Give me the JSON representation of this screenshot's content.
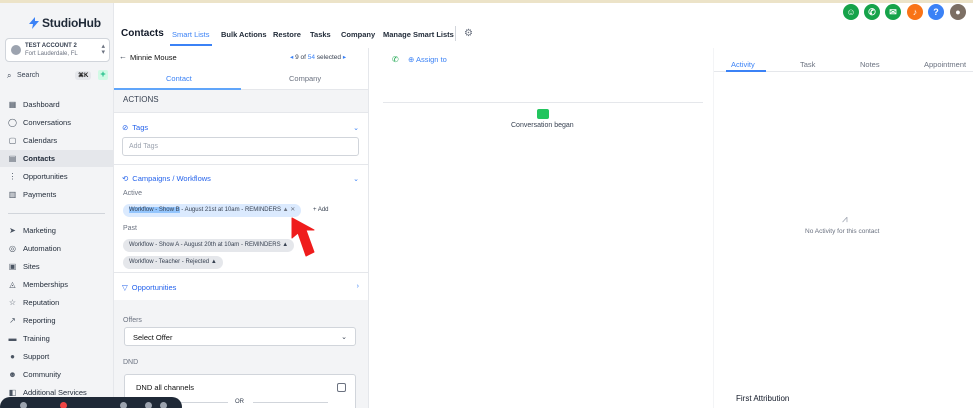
{
  "brand": {
    "name": "StudioHub"
  },
  "account": {
    "name": "TEST ACCOUNT 2",
    "location": "Fort Lauderdale, FL"
  },
  "search": {
    "label": "Search",
    "shortcut": "⌘K"
  },
  "sidebar": {
    "items": [
      {
        "label": "Dashboard",
        "icon": "dashboard-icon"
      },
      {
        "label": "Conversations",
        "icon": "chat-icon"
      },
      {
        "label": "Calendars",
        "icon": "calendar-icon"
      },
      {
        "label": "Contacts",
        "icon": "contacts-icon"
      },
      {
        "label": "Opportunities",
        "icon": "opportunities-icon"
      },
      {
        "label": "Payments",
        "icon": "payments-icon"
      },
      {
        "label": "Marketing",
        "icon": "send-icon"
      },
      {
        "label": "Automation",
        "icon": "automation-icon"
      },
      {
        "label": "Sites",
        "icon": "sites-icon"
      },
      {
        "label": "Memberships",
        "icon": "memberships-icon"
      },
      {
        "label": "Reputation",
        "icon": "star-icon"
      },
      {
        "label": "Reporting",
        "icon": "reporting-icon"
      },
      {
        "label": "Training",
        "icon": "training-icon"
      },
      {
        "label": "Support",
        "icon": "support-icon"
      },
      {
        "label": "Community",
        "icon": "community-icon"
      },
      {
        "label": "Additional Services",
        "icon": "services-icon"
      }
    ],
    "active": "Contacts"
  },
  "header": {
    "title": "Contacts",
    "tabs": [
      "Smart Lists",
      "Bulk Actions",
      "Restore",
      "Tasks",
      "Company",
      "Manage Smart Lists"
    ],
    "selected_tab": "Smart Lists"
  },
  "topicons": [
    {
      "color": "#16a34a",
      "glyph": "☺"
    },
    {
      "color": "#16a34a",
      "glyph": "✆"
    },
    {
      "color": "#16a34a",
      "glyph": "✉"
    },
    {
      "color": "#f97316",
      "glyph": "♪"
    },
    {
      "color": "#3b82f6",
      "glyph": "?"
    },
    {
      "color": "#7c6f64",
      "glyph": "●"
    }
  ],
  "contact": {
    "name": "Minnie Mouse",
    "page_of": "9 of",
    "total": "54",
    "selected": "selected",
    "tabs": [
      "Contact",
      "Company"
    ]
  },
  "actions": {
    "label": "ACTIONS"
  },
  "tags": {
    "title": "Tags",
    "placeholder": "Add Tags"
  },
  "campaigns": {
    "title": "Campaigns / Workflows",
    "active_label": "Active",
    "past_label": "Past",
    "add_label": "+ Add",
    "active_chip": {
      "highlight": "Workflow - Show B",
      "rest": " - August 21st at 10am - REMINDERS"
    },
    "past_chips": [
      "Workflow - Show A - August 20th at 10am - REMINDERS",
      "Workflow - Teacher - Rejected"
    ]
  },
  "opportunities": {
    "title": "Opportunities"
  },
  "offers": {
    "label": "Offers",
    "value": "Select Offer"
  },
  "dnd": {
    "label": "DND",
    "all": "DND all channels",
    "or": "OR"
  },
  "middle": {
    "assign": "Assign to",
    "conversation": "Conversation began"
  },
  "right": {
    "tabs": [
      "Activity",
      "Task",
      "Notes",
      "Appointment"
    ],
    "empty": "No Activity for this contact",
    "first_attribution": "First Attribution"
  }
}
